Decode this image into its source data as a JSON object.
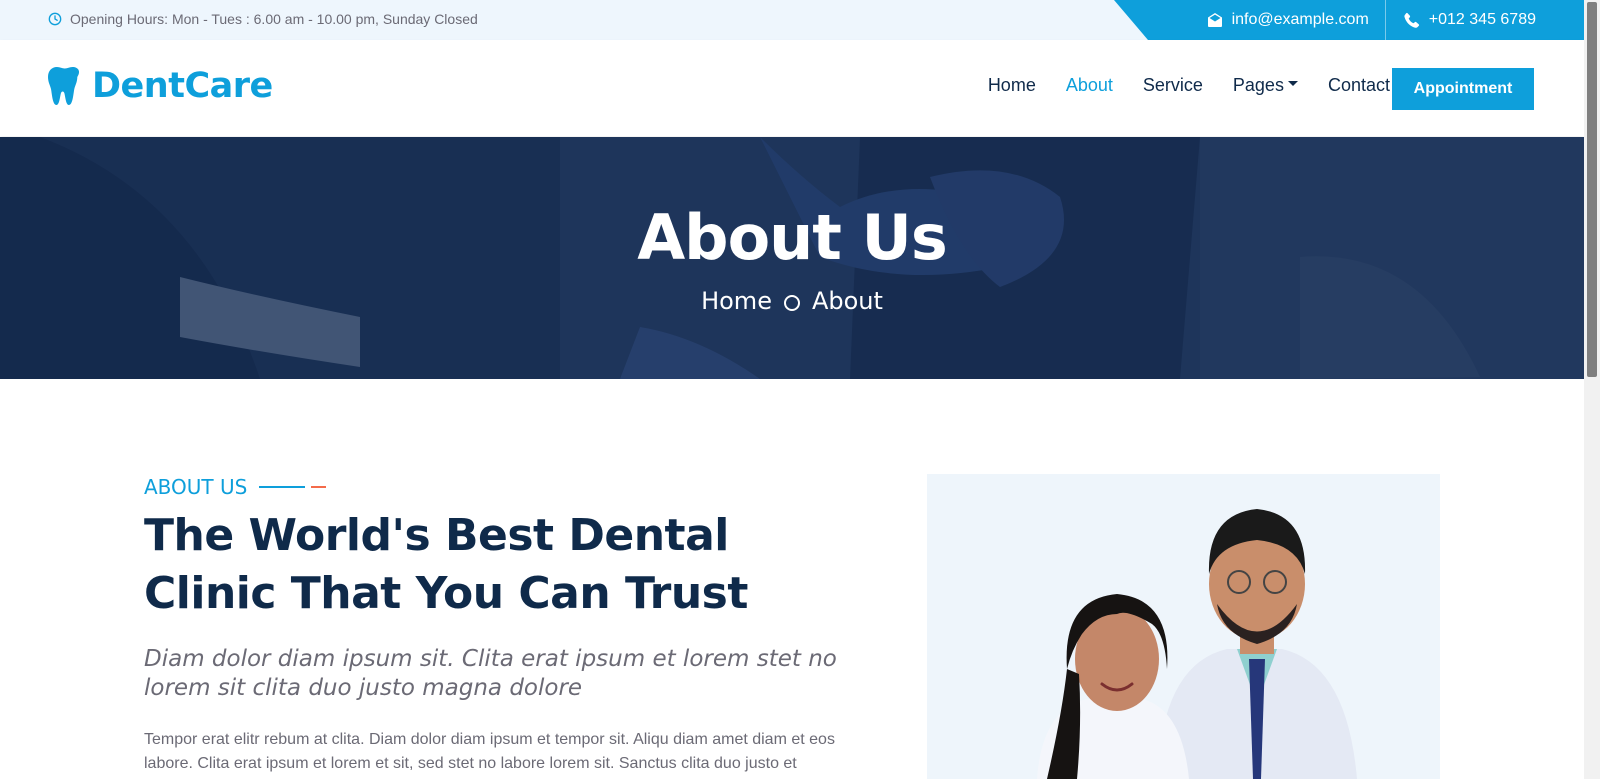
{
  "topbar": {
    "hours": "Opening Hours: Mon - Tues : 6.00 am - 10.00 pm, Sunday Closed",
    "email": "info@example.com",
    "phone": "+012 345 6789"
  },
  "brand": {
    "name": "DentCare",
    "logo_icon": "tooth-icon"
  },
  "nav": {
    "items": [
      "Home",
      "About",
      "Service",
      "Pages",
      "Contact"
    ],
    "active": "About",
    "appointment_label": "Appointment"
  },
  "hero": {
    "title": "About Us",
    "breadcrumb": [
      "Home",
      "About"
    ]
  },
  "about": {
    "eyebrow": "ABOUT US",
    "title": "The World's Best Dental Clinic That You Can Trust",
    "lead": "Diam dolor diam ipsum sit. Clita erat ipsum et lorem stet no lorem sit clita duo justo magna dolore",
    "text": "Tempor erat elitr rebum at clita. Diam dolor diam ipsum et tempor sit. Aliqu diam amet diam et eos labore. Clita erat ipsum et lorem et sit, sed stet no labore lorem sit. Sanctus clita duo justo et"
  },
  "colors": {
    "accent": "#0e9fdb",
    "dark": "#0f2a4a",
    "secondary": "#f46b4a",
    "topbar_bg": "#eef6fd"
  }
}
